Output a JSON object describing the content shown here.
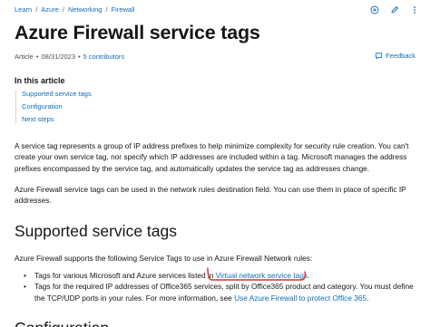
{
  "breadcrumb": {
    "items": [
      "Learn",
      "Azure",
      "Networking",
      "Firewall"
    ],
    "separator": "/"
  },
  "top_icons": [
    "add-collection-icon",
    "edit-icon",
    "more-icon"
  ],
  "page": {
    "title": "Azure Firewall service tags",
    "article_label": "Article",
    "date": "08/31/2023",
    "meta_sep": "•",
    "contributors": "5 contributors",
    "feedback": "Feedback"
  },
  "toc": {
    "heading": "In this article",
    "items": [
      "Supported service tags",
      "Configuration",
      "Next steps"
    ]
  },
  "body": {
    "para1": "A service tag represents a group of IP address prefixes to help minimize complexity for security rule creation. You can't create your own service tag, nor specify which IP addresses are included within a tag. Microsoft manages the address prefixes encompassed by the service tag, and automatically updates the service tag as addresses change.",
    "para2": "Azure Firewall service tags can be used in the network rules destination field. You can use them in place of specific IP addresses.",
    "section_heading": "Supported service tags",
    "para3": "Azure Firewall supports the following Service Tags to use in Azure Firewall Network rules:",
    "bullet1_text": "Tags for various Microsoft and Azure services listed in ",
    "bullet1_link": "Virtual network service tags",
    "bullet1_end": ".",
    "bullet2_text": "Tags for the required IP addresses of Office365 services, split by Office365 product and category. You must define the TCP/UDP ports in your rules. For more information, see ",
    "bullet2_link": "Use Azure Firewall to protect Office 365",
    "bullet2_end": ".",
    "next_heading_partial": "Configuration"
  },
  "colors": {
    "link": "#0f6cbd",
    "text": "#161616",
    "annotation": "#d9322b"
  }
}
